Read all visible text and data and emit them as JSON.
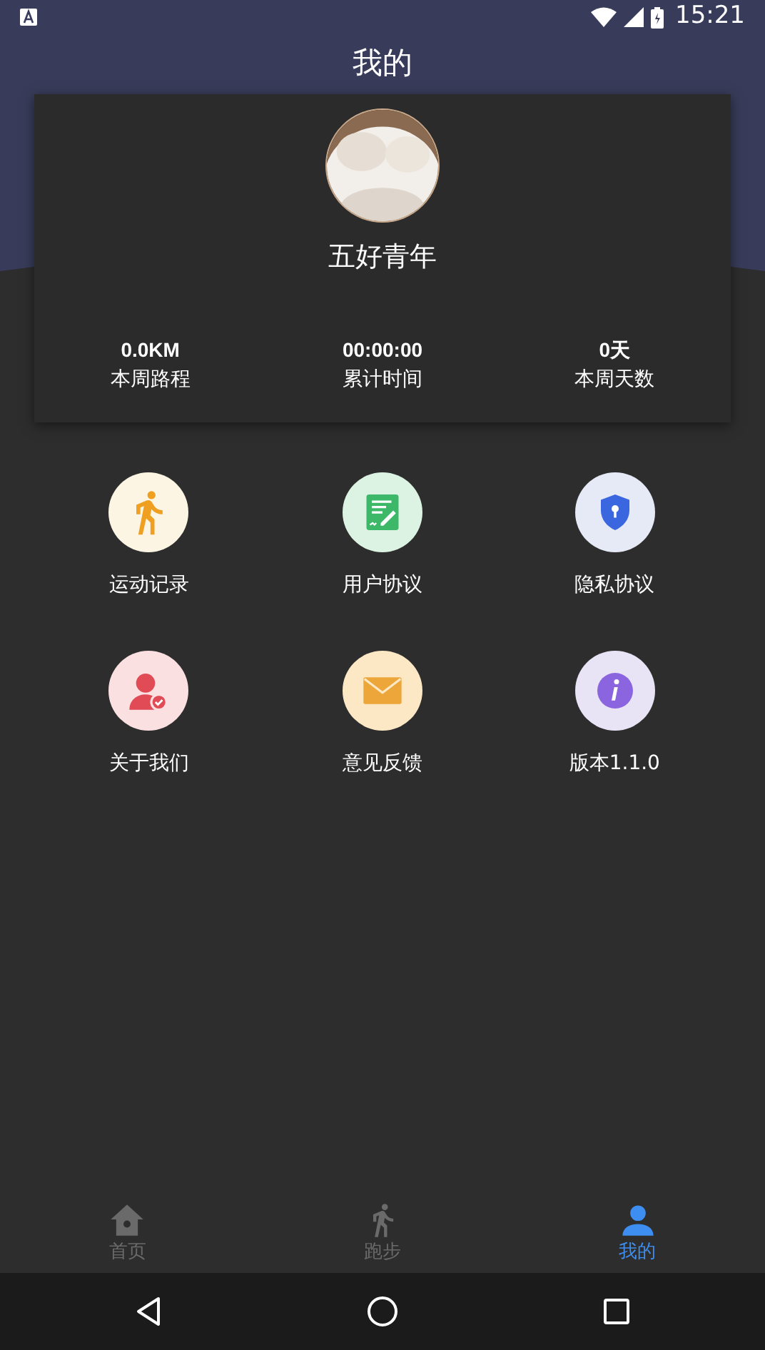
{
  "status_bar": {
    "time": "15:21"
  },
  "header": {
    "title": "我的"
  },
  "profile": {
    "name": "五好青年",
    "stats": [
      {
        "value": "0.0KM",
        "label": "本周路程"
      },
      {
        "value": "00:00:00",
        "label": "累计时间"
      },
      {
        "value": "0天",
        "label": "本周天数"
      }
    ]
  },
  "menu": [
    {
      "kind": "run",
      "label": "运动记录",
      "color": "#f0a020"
    },
    {
      "kind": "agreement",
      "label": "用户协议",
      "color": "#3cb868"
    },
    {
      "kind": "privacy",
      "label": "隐私协议",
      "color": "#3a66e0"
    },
    {
      "kind": "about",
      "label": "关于我们",
      "color": "#e04b55"
    },
    {
      "kind": "feedback",
      "label": "意见反馈",
      "color": "#eca63a"
    },
    {
      "kind": "version",
      "label": "版本1.1.0",
      "color": "#8b64e0"
    }
  ],
  "bottom_nav": [
    {
      "kind": "home",
      "label": "首页",
      "selected": false
    },
    {
      "kind": "run",
      "label": "跑步",
      "selected": false
    },
    {
      "kind": "me",
      "label": "我的",
      "selected": true
    }
  ]
}
